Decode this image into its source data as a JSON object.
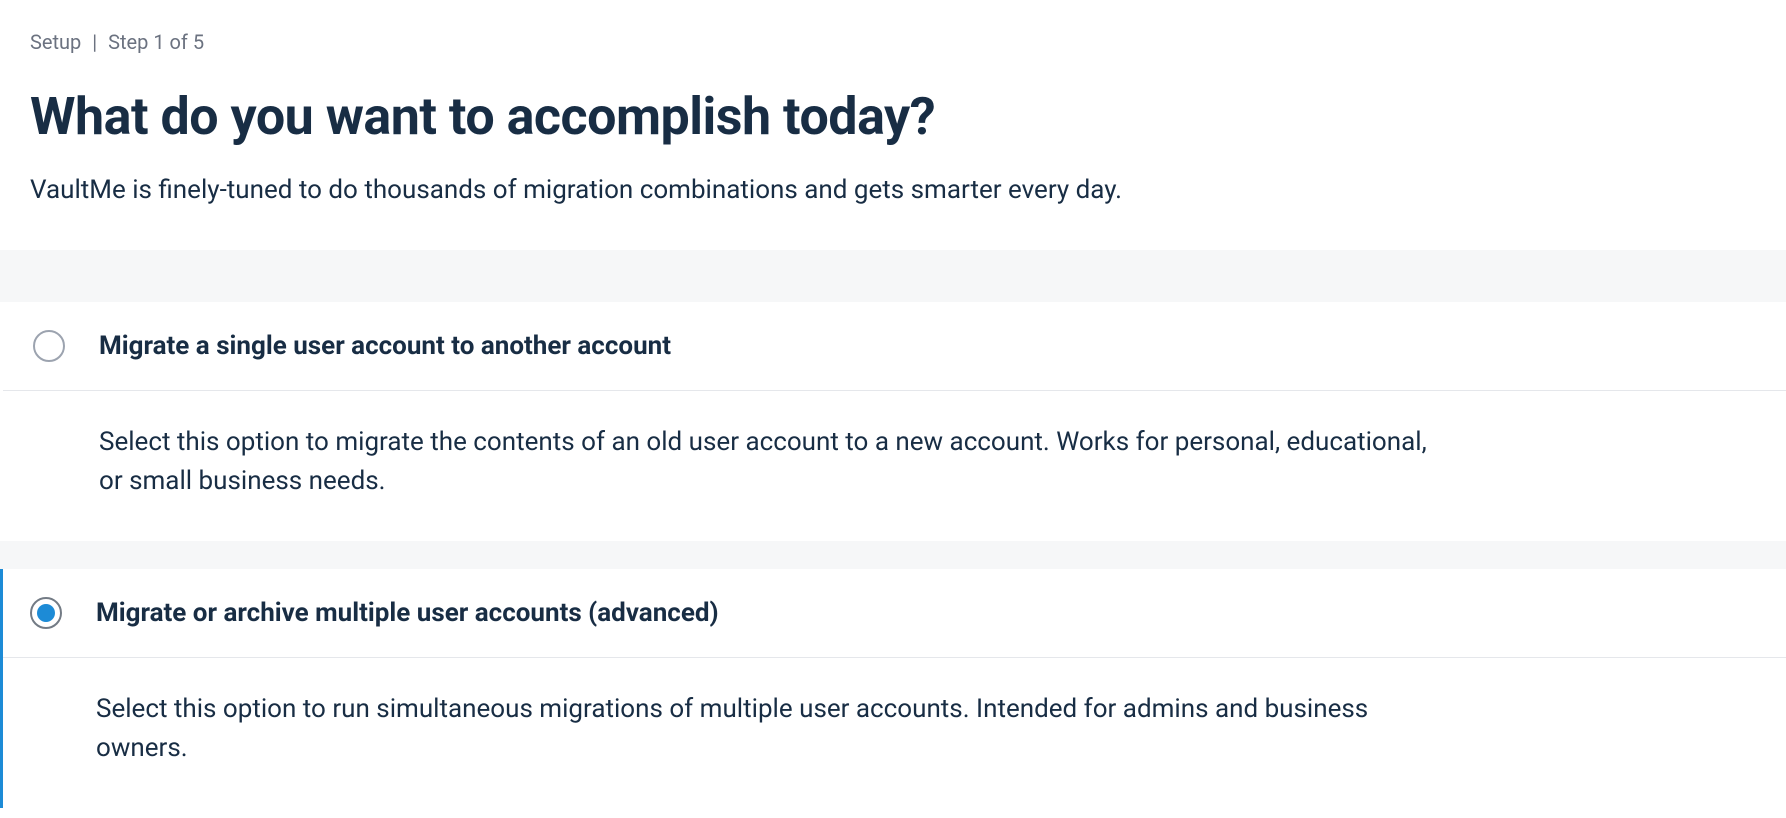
{
  "breadcrumb": {
    "section": "Setup",
    "step": "Step 1 of 5"
  },
  "page": {
    "title": "What do you want to accomplish today?",
    "subtitle": "VaultMe is finely-tuned to do thousands of migration combinations and gets smarter every day."
  },
  "options": [
    {
      "title": "Migrate a single user account to another account",
      "description": "Select this option to migrate the contents of an old user account to a new account. Works for personal, educational, or small business needs.",
      "selected": false
    },
    {
      "title": "Migrate or archive multiple user accounts (advanced)",
      "description": "Select this option to run simultaneous migrations of multiple user accounts. Intended for admins and business owners.",
      "selected": true
    }
  ],
  "colors": {
    "primary_text": "#182d44",
    "accent": "#1d8bd6",
    "muted": "#6b7280",
    "band": "#f6f7f8"
  }
}
